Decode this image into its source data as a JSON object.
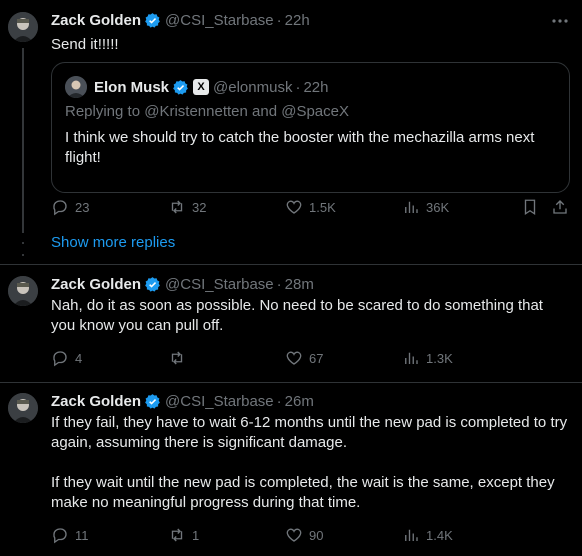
{
  "tweets": [
    {
      "name": "Zack Golden",
      "handle": "@CSI_Starbase",
      "separator": "·",
      "time": "22h",
      "text": "Send it!!!!!",
      "quote": {
        "name": "Elon Musk",
        "badge": "X",
        "handle": "@elonmusk",
        "separator": "·",
        "time": "22h",
        "replying_prefix": "Replying to",
        "replying_to_1": "@Kristennetten",
        "replying_and": "and",
        "replying_to_2": "@SpaceX",
        "text": "I think we should try to catch the booster with the mechazilla arms next flight!"
      },
      "replies": "23",
      "reposts": "32",
      "likes": "1.5K",
      "views": "36K"
    },
    {
      "name": "Zack Golden",
      "handle": "@CSI_Starbase",
      "separator": "·",
      "time": "28m",
      "text": "Nah, do it as soon as possible. No need to be scared to do something that you know you can pull off.",
      "replies": "4",
      "reposts": "",
      "likes": "67",
      "views": "1.3K"
    },
    {
      "name": "Zack Golden",
      "handle": "@CSI_Starbase",
      "separator": "·",
      "time": "26m",
      "text_p1": "If they fail, they have to wait 6-12 months until the new pad is completed to try again, assuming there is significant damage.",
      "text_p2": "If they wait until the new pad is completed, the wait is the same, except they make no meaningful progress during that time.",
      "replies": "11",
      "reposts": "1",
      "likes": "90",
      "views": "1.4K"
    }
  ],
  "show_more": "Show more replies",
  "colors": {
    "accent": "#1d9bf0",
    "muted": "#71767b",
    "text": "#e7e9ea",
    "bg": "#000000"
  },
  "icons": [
    "avatar",
    "verified-badge-icon",
    "more-icon",
    "reply-icon",
    "repost-icon",
    "like-icon",
    "views-icon",
    "bookmark-icon",
    "share-icon"
  ]
}
